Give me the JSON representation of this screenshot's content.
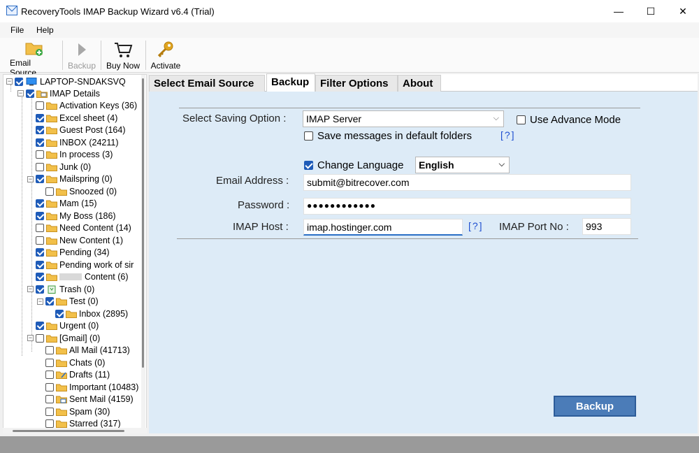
{
  "window": {
    "title": "RecoveryTools IMAP Backup Wizard v6.4 (Trial)",
    "minimize": "—",
    "maximize": "☐",
    "close": "✕"
  },
  "menu": [
    "File",
    "Help"
  ],
  "toolbar": {
    "email_source": "Email Source",
    "backup": "Backup",
    "buy_now": "Buy Now",
    "activate": "Activate"
  },
  "tree": {
    "root": "LAPTOP-SNDAKSVQ",
    "items": [
      {
        "label": "IMAP Details",
        "checked": true
      },
      {
        "label": "Activation Keys (36)",
        "checked": false
      },
      {
        "label": "Excel sheet (4)",
        "checked": true
      },
      {
        "label": "Guest Post (164)",
        "checked": true
      },
      {
        "label": "INBOX (24211)",
        "checked": true
      },
      {
        "label": "In process (3)",
        "checked": false
      },
      {
        "label": "Junk (0)",
        "checked": false
      },
      {
        "label": "Mailspring (0)",
        "checked": true
      },
      {
        "label": "Snoozed (0)",
        "checked": false
      },
      {
        "label": "Mam (15)",
        "checked": true
      },
      {
        "label": "My Boss (186)",
        "checked": true
      },
      {
        "label": "Need Content (14)",
        "checked": false
      },
      {
        "label": "New Content (1)",
        "checked": false
      },
      {
        "label": "Pending (34)",
        "checked": true
      },
      {
        "label": "Pending work of sir",
        "checked": true
      },
      {
        "label": "Content (6)",
        "checked": true
      },
      {
        "label": "Trash (0)",
        "checked": true
      },
      {
        "label": "Test (0)",
        "checked": true
      },
      {
        "label": "Inbox (2895)",
        "checked": true
      },
      {
        "label": "Urgent (0)",
        "checked": true
      },
      {
        "label": "[Gmail] (0)",
        "checked": false
      },
      {
        "label": "All Mail (41713)",
        "checked": false
      },
      {
        "label": "Chats (0)",
        "checked": false
      },
      {
        "label": "Drafts (11)",
        "checked": false
      },
      {
        "label": "Important (10483)",
        "checked": false
      },
      {
        "label": "Sent Mail (4159)",
        "checked": false
      },
      {
        "label": "Spam (30)",
        "checked": false
      },
      {
        "label": "Starred (317)",
        "checked": false
      }
    ]
  },
  "tabs": [
    "Select Email Source",
    "Backup",
    "Filter Options",
    "About"
  ],
  "form": {
    "saving_option_label": "Select Saving Option :",
    "saving_option_value": "IMAP Server",
    "advance_mode_label": "Use Advance Mode",
    "save_default_label": "Save messages in default folders",
    "help1": "[?]",
    "change_language_label": "Change Language",
    "language_value": "English",
    "email_label": "Email Address :",
    "email_value": "submit@bitrecover.com",
    "password_label": "Password :",
    "password_value": "●●●●●●●●●●●●",
    "host_label": "IMAP Host :",
    "host_value": "imap.hostinger.com",
    "help2": "[?]",
    "port_label": "IMAP Port No :",
    "port_value": "993"
  },
  "backup_button": "Backup",
  "colors": {
    "accent": "#1e5bb8",
    "content_bg": "#ddebf7",
    "backup_button": "#4b7cb8",
    "link": "#1f4fd0"
  }
}
